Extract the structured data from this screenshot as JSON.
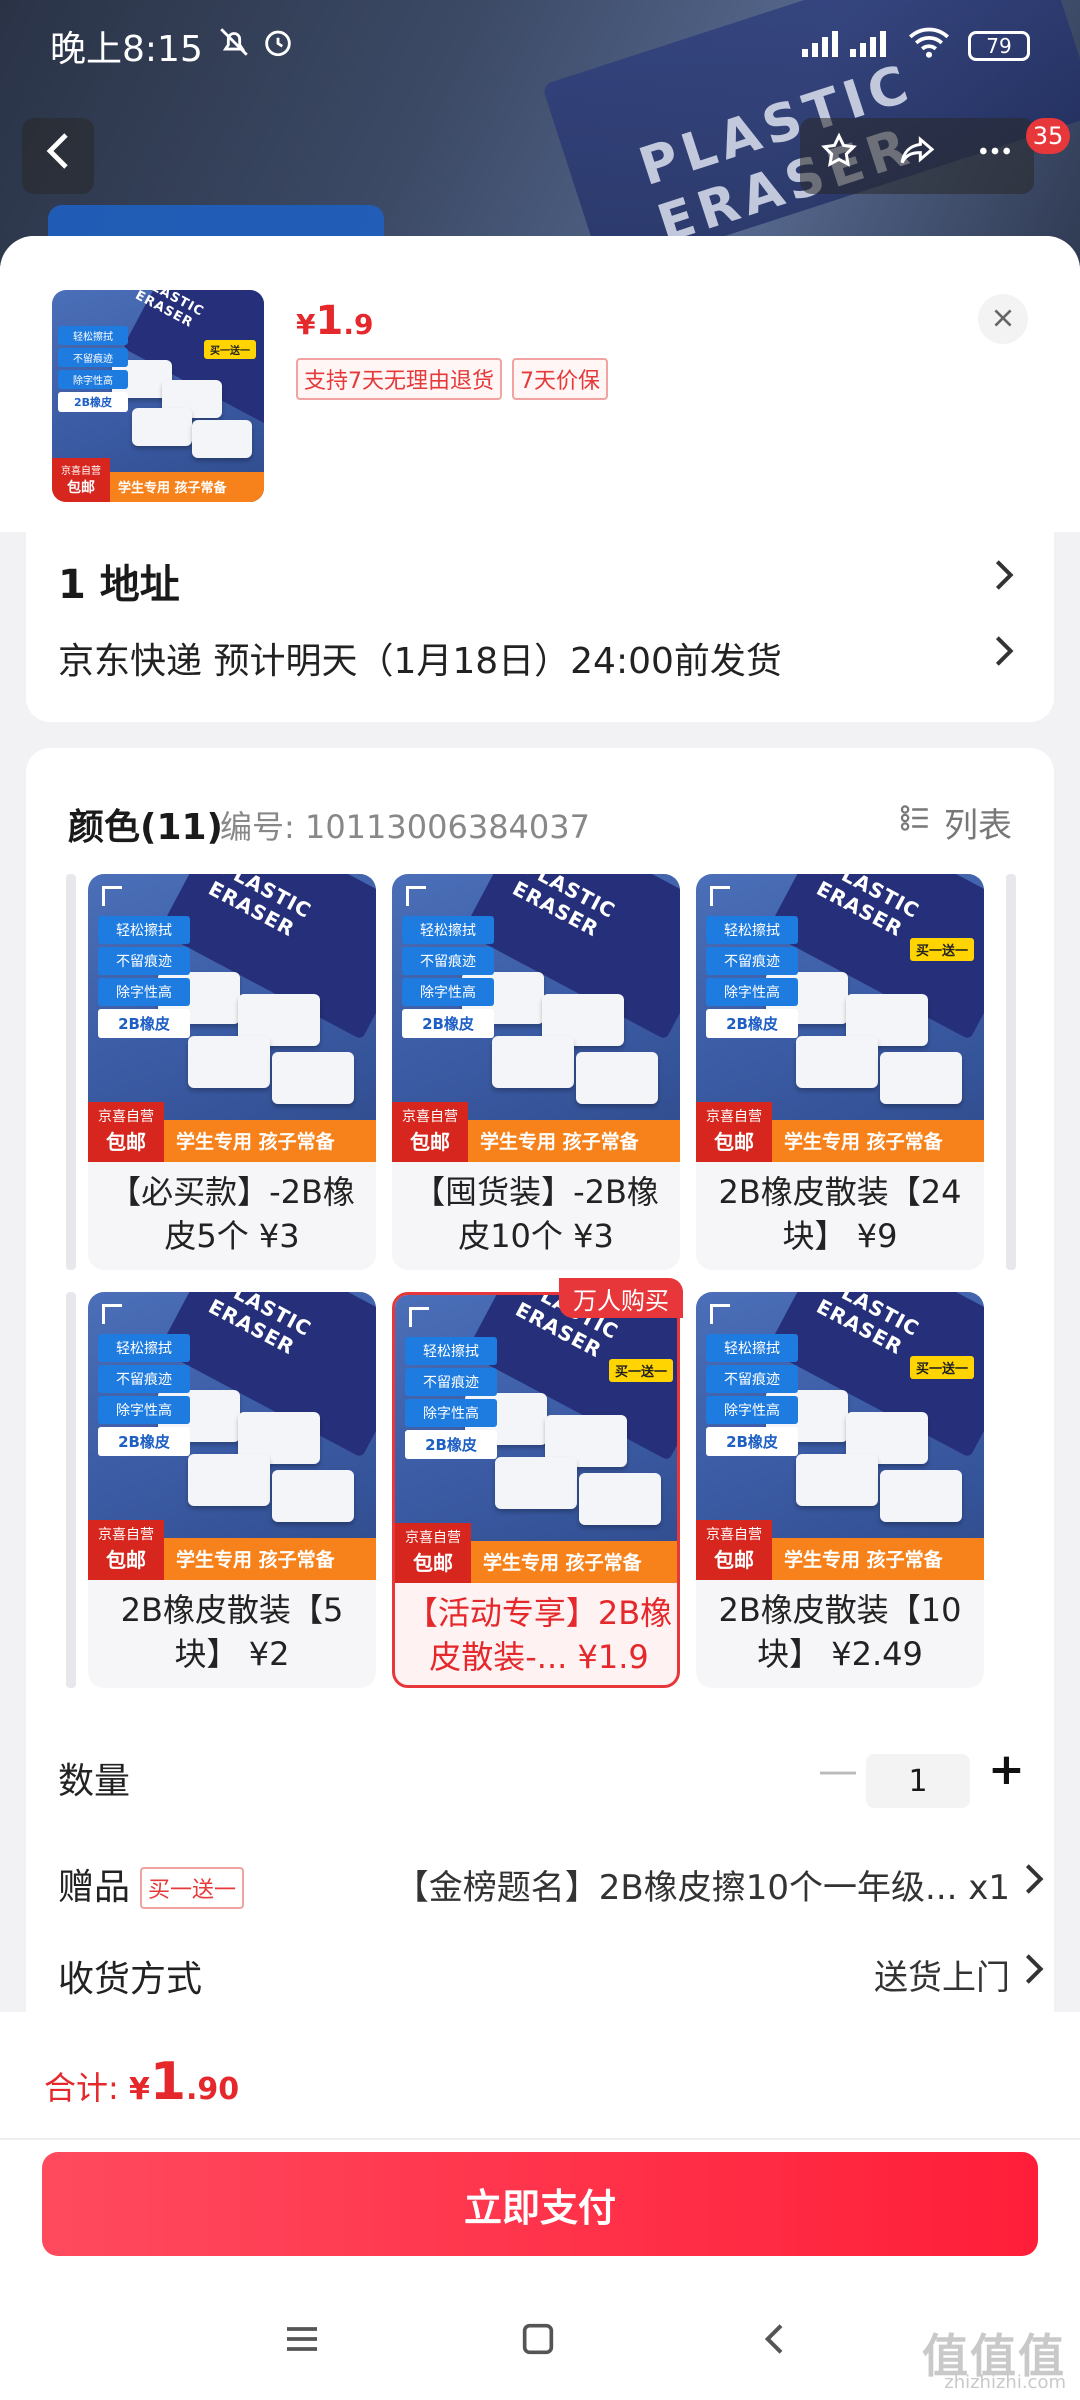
{
  "status_bar": {
    "time": "晚上8:15",
    "battery": "79",
    "mute_icon": "bell-off-icon",
    "alarm_icon": "alarm-icon",
    "signal_icon": "signal-icon",
    "wifi_icon": "wifi-icon"
  },
  "header": {
    "back_icon": "chevron-left-icon",
    "favorite_icon": "star-icon",
    "share_icon": "share-icon",
    "more_icon": "more-icon",
    "badge_count": "35"
  },
  "product": {
    "price_symbol": "¥",
    "price_int": "1",
    "price_dec": ".9",
    "tags": [
      "支持7天无理由退货",
      "7天价保"
    ]
  },
  "address": {
    "line1": "1  地址",
    "shipping": "京东快递 预计明天（1月18日）24:00前发货"
  },
  "spec": {
    "title": "颜色(11)",
    "sku": "编号: 10113006384037",
    "list_toggle": "列表",
    "hot_badge": "万人购买",
    "items": [
      {
        "label": "【必买款】-2B橡皮5个 ¥3",
        "selected": false
      },
      {
        "label": "【囤货装】-2B橡皮10个 ¥3",
        "selected": false
      },
      {
        "label": "2B橡皮散装【24块】 ¥9",
        "selected": false
      },
      {
        "label": "2B橡皮散装【5块】 ¥2",
        "selected": false
      },
      {
        "label": "【活动专享】2B橡皮散装-... ¥1.9",
        "selected": true
      },
      {
        "label": "2B橡皮散装【10块】 ¥2.49",
        "selected": false
      }
    ]
  },
  "artwork": {
    "pack_text": "PLASTIC ERASER",
    "bubble1": "轻松擦拭",
    "bubble2": "不留痕迹",
    "bubble3": "除字性高",
    "bubble4": "2B橡皮",
    "gift": "买一送一",
    "red_top": "京喜自营",
    "red_main": "包邮",
    "bar_text": "学生专用 孩子常备"
  },
  "options": {
    "quantity_label": "数量",
    "quantity_value": "1",
    "minus": "—",
    "plus": "+",
    "gift_label": "赠品",
    "gift_tag": "买一送一",
    "gift_value": "【金榜题名】2B橡皮擦10个一年级... x1",
    "delivery_label": "收货方式",
    "delivery_value": "送货上门"
  },
  "bottom": {
    "total_prefix": "合计: ",
    "total_symbol": "¥",
    "total_int": "1",
    "total_dec": ".90",
    "pay_button": "立即支付"
  },
  "nav": {
    "menu_icon": "menu-icon",
    "home_icon": "home-icon",
    "back_icon": "back-icon"
  },
  "watermark": {
    "main": "值值值",
    "sub": "zhizhizhi.com"
  },
  "colors": {
    "accent": "#e5282b",
    "pay_gradient_start": "#ff4a5e",
    "pay_gradient_end": "#ff1e39"
  }
}
